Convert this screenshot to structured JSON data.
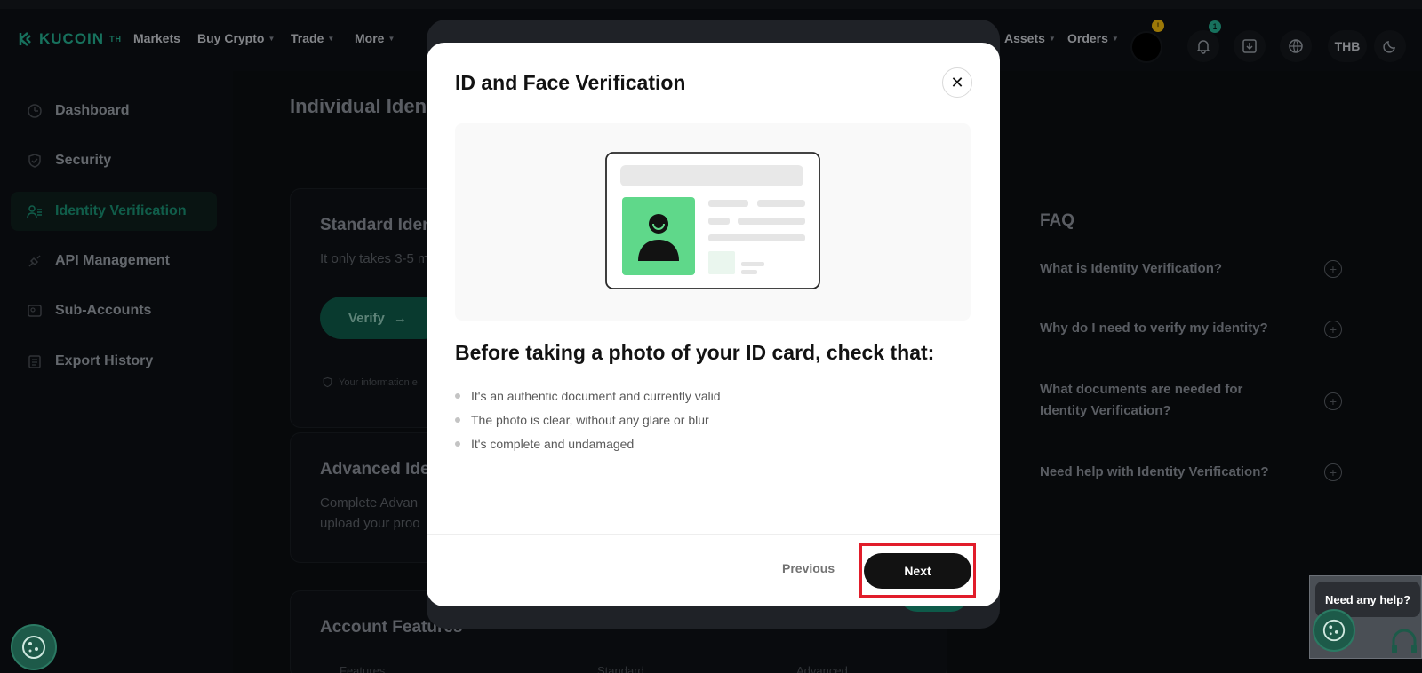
{
  "topnav": {
    "logo": "KUCOIN",
    "logo_suffix": "TH",
    "items": [
      "Markets",
      "Buy Crypto",
      "Trade",
      "More"
    ],
    "assets": "Assets",
    "orders": "Orders",
    "currency": "THB",
    "avatar_badge": "!",
    "notification_badge": "1"
  },
  "sidebar": {
    "items": [
      {
        "label": "Dashboard",
        "icon": "dashboard-icon"
      },
      {
        "label": "Security",
        "icon": "shield-icon"
      },
      {
        "label": "Identity Verification",
        "icon": "user-id-icon",
        "active": true
      },
      {
        "label": "API Management",
        "icon": "api-icon"
      },
      {
        "label": "Sub-Accounts",
        "icon": "sub-accounts-icon"
      },
      {
        "label": "Export History",
        "icon": "export-icon"
      }
    ]
  },
  "main": {
    "title": "Individual Iden",
    "standard": {
      "title": "Standard Iden",
      "subtitle": "It only takes 3-5 m",
      "verify": "Verify",
      "note": "Your information e"
    },
    "advanced": {
      "title": "Advanced Ide",
      "subtitle_1": "Complete Advan",
      "subtitle_2": "upload your proo"
    },
    "features": {
      "title": "Account Features",
      "col_1": "Features",
      "col_2": "Standard",
      "col_3": "Advanced"
    }
  },
  "faq": {
    "title": "FAQ",
    "questions": [
      "What is Identity Verification?",
      "Why do I need to verify my identity?",
      "What documents are needed for Identity Verification?",
      "Need help with Identity Verification?"
    ]
  },
  "modal": {
    "title": "ID and Face Verification",
    "check_title": "Before taking a photo of your ID card, check that:",
    "bullets": [
      "It's an authentic document and currently valid",
      "The photo is clear, without any glare or blur",
      "It's complete and undamaged"
    ],
    "previous": "Previous",
    "next": "Next"
  },
  "help": {
    "label": "Need any help?"
  },
  "colors": {
    "accent": "#24ae8f",
    "highlight": "#e11d2a",
    "id_photo": "#5fd88a"
  }
}
